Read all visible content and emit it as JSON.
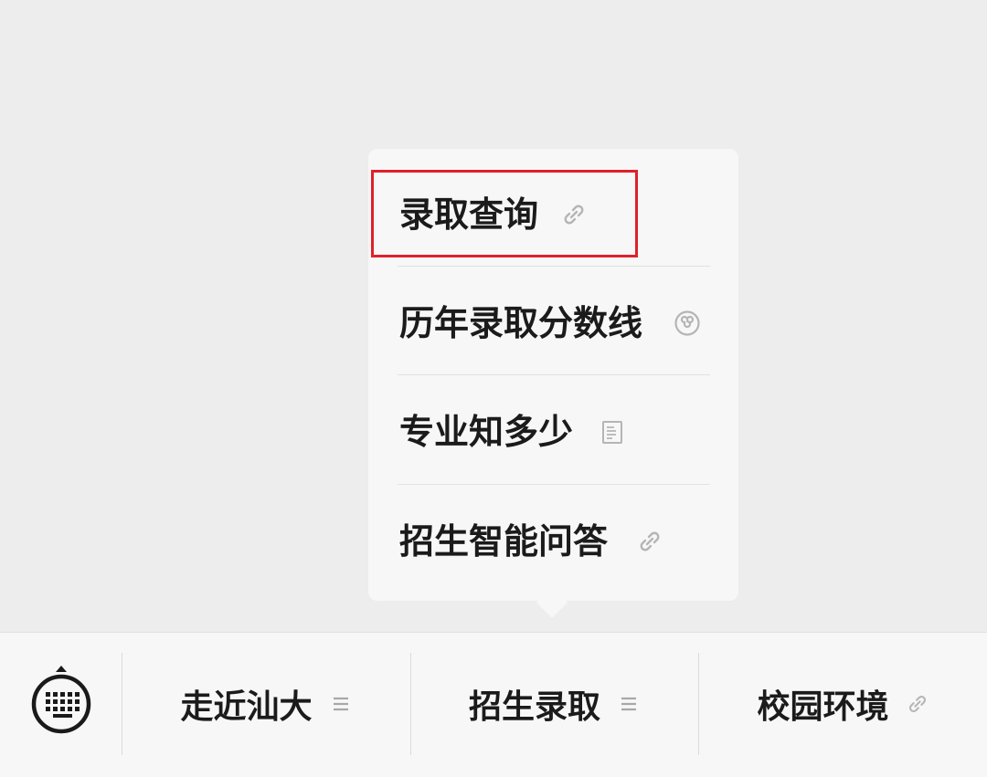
{
  "submenu": {
    "items": [
      {
        "label": "录取查询",
        "icon": "link-icon"
      },
      {
        "label": "历年录取分数线",
        "icon": "mini-program-icon"
      },
      {
        "label": "专业知多少",
        "icon": "article-icon"
      },
      {
        "label": "招生智能问答",
        "icon": "link-icon"
      }
    ],
    "highlighted_index": 0,
    "highlight_color": "#e0202b"
  },
  "bottom_menu": {
    "keyboard_icon": "keyboard-icon",
    "tabs": [
      {
        "label": "走近汕大",
        "icon": "submenu-list-icon"
      },
      {
        "label": "招生录取",
        "icon": "submenu-list-icon"
      },
      {
        "label": "校园环境",
        "icon": "link-icon"
      }
    ]
  }
}
